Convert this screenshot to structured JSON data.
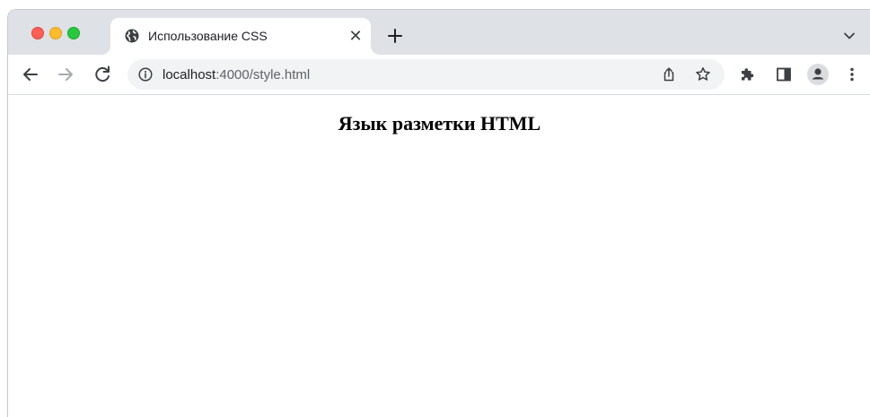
{
  "browser": {
    "tab": {
      "title": "Использование CSS",
      "close_glyph": "✕"
    },
    "new_tab_glyph": "+",
    "address_bar": {
      "host": "localhost",
      "rest": ":4000/style.html"
    },
    "icons": {
      "favicon": "globe-icon",
      "back": "arrow-left-icon",
      "forward": "arrow-right-icon",
      "reload": "reload-icon",
      "info": "info-icon",
      "share": "share-icon",
      "bookmark": "star-icon",
      "extensions": "puzzle-icon",
      "side_panel": "side-panel-icon",
      "profile": "profile-icon",
      "menu": "kebab-menu-icon",
      "tab_search": "chevron-down-icon"
    },
    "colors": {
      "tabstrip": "#dee1e6",
      "omnibox": "#f1f3f4",
      "close": "#fe5f57",
      "minimize": "#febc2e",
      "maximize": "#28c840"
    }
  },
  "page": {
    "heading": "Язык разметки HTML"
  }
}
